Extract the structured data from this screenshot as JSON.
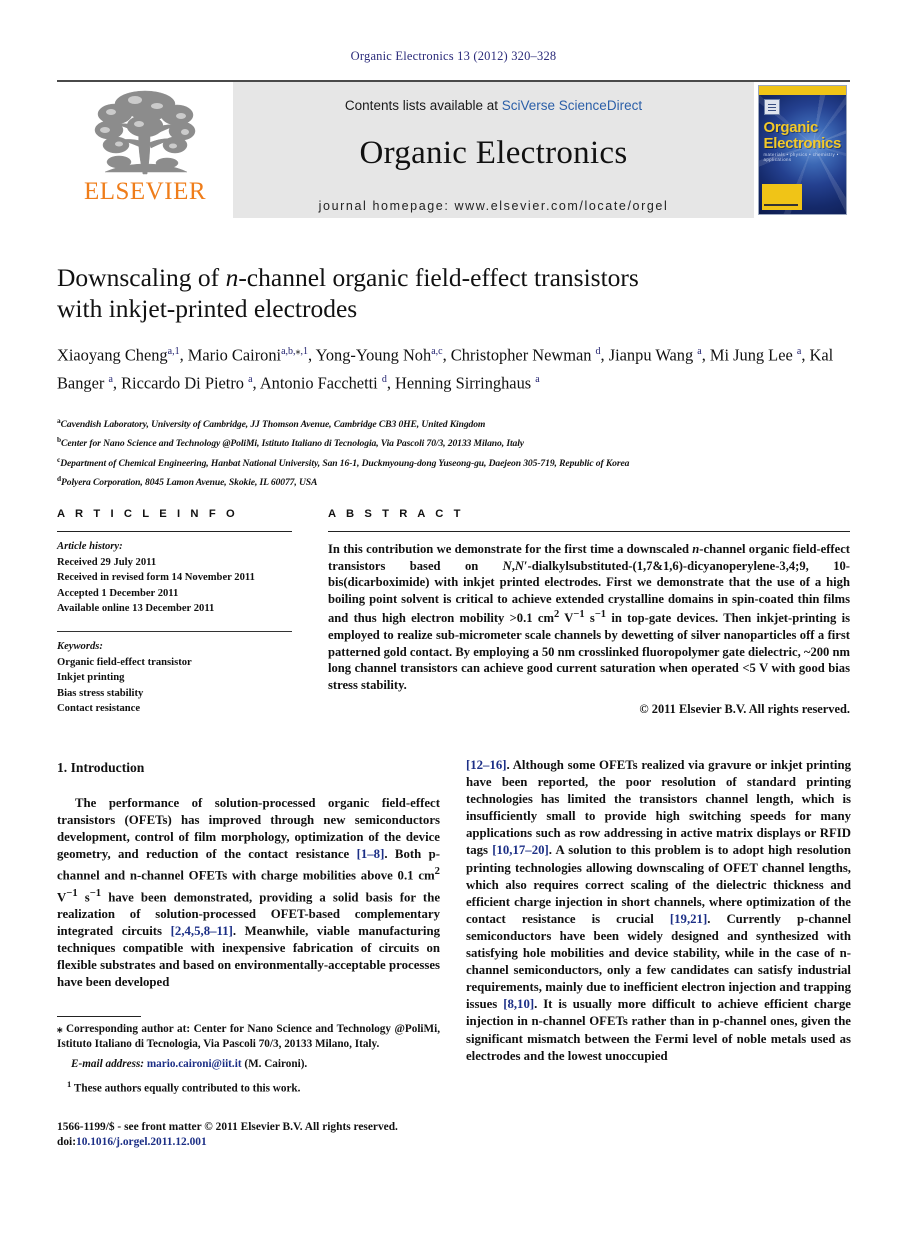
{
  "runhead": "Organic Electronics 13 (2012) 320–328",
  "masthead": {
    "contents_prefix": "Contents lists available at ",
    "sciencedirect": "SciVerse ScienceDirect",
    "journal_name": "Organic Electronics",
    "homepage": "journal homepage: www.elsevier.com/locate/orgel",
    "publisher_logo_text": "ELSEVIER",
    "cover": {
      "line1": "Organic",
      "line2": "Electronics",
      "subtitle": "materials • physics • chemistry • applications"
    },
    "accent_orange": "#ef7d1a",
    "link_blue": "#2b5fa8",
    "band_gray": "#e6e6e6"
  },
  "article": {
    "title_line1_a": "Downscaling of ",
    "title_line1_italic": "n",
    "title_line1_b": "-channel organic field-effect transistors",
    "title_line2": "with inkjet-printed electrodes",
    "authors_html": "Xiaoyang Cheng<sup>a,1</sup>, Mario Caironi<sup>a,b,<span class=\"star\">⁎</span>,1</sup>, Yong-Young Noh<sup>a,c</sup>, Christopher Newman <sup>d</sup>, Jianpu Wang <sup>a</sup>, Mi Jung Lee <sup>a</sup>, Kal Banger <sup>a</sup>, Riccardo Di Pietro <sup>a</sup>, Antonio Facchetti <sup>d</sup>, Henning Sirringhaus <sup>a</sup>",
    "affiliations": [
      {
        "mark": "a",
        "text": "Cavendish Laboratory, University of Cambridge, JJ Thomson Avenue, Cambridge CB3 0HE, United Kingdom"
      },
      {
        "mark": "b",
        "text": "Center for Nano Science and Technology @PoliMi, Istituto Italiano di Tecnologia, Via Pascoli 70/3, 20133 Milano, Italy"
      },
      {
        "mark": "c",
        "text": "Department of Chemical Engineering, Hanbat National University, San 16-1, Duckmyoung-dong Yuseong-gu, Daejeon 305-719, Republic of Korea"
      },
      {
        "mark": "d",
        "text": "Polyera Corporation, 8045 Lamon Avenue, Skokie, IL 60077, USA"
      }
    ]
  },
  "info": {
    "heading": "A R T I C L E   I N F O",
    "history_label": "Article history:",
    "history": [
      "Received 29 July 2011",
      "Received in revised form 14 November 2011",
      "Accepted 1 December 2011",
      "Available online 13 December 2011"
    ],
    "keywords_label": "Keywords:",
    "keywords": [
      "Organic field-effect transistor",
      "Inkjet printing",
      "Bias stress stability",
      "Contact resistance"
    ]
  },
  "abstract": {
    "heading": "A B S T R A C T",
    "body_html": "In this contribution we demonstrate for the first time a downscaled <i>n</i>-channel organic field-effect transistors based on <i>N</i>,<i>N</i>′-dialkylsubstituted-(1,7&amp;1,6)-dicyanoperylene-3,4;9, 10-bis(dicarboximide) with inkjet printed electrodes. First we demonstrate that the use of a high boiling point solvent is critical to achieve extended crystalline domains in spin-coated thin films and thus high electron mobility &gt;0.1 cm<sup>2</sup> V<sup>−1</sup> s<sup>−1</sup> in top-gate devices. Then inkjet-printing is employed to realize sub-micrometer scale channels by dewetting of silver nanoparticles off a first patterned gold contact. By employing a 50 nm crosslinked fluoropolymer gate dielectric, ~200 nm long channel transistors can achieve good current saturation when operated &lt;5 V with good bias stress stability.",
    "copyright": "© 2011 Elsevier B.V. All rights reserved."
  },
  "body": {
    "section_heading": "1. Introduction",
    "left_paragraph_html": "The performance of solution-processed organic field-effect transistors (OFETs) has improved through new semiconductors development, control of film morphology, optimization of the device geometry, and reduction of the contact resistance <span class=\"ref\">[1–8]</span>. Both p-channel and n-channel OFETs with charge mobilities above 0.1 cm<sup>2</sup> V<sup>−1</sup> s<sup>−1</sup> have been demonstrated, providing a solid basis for the realization of solution-processed OFET-based complementary integrated circuits <span class=\"ref\">[2,4,5,8–11]</span>. Meanwhile, viable manufacturing techniques compatible with inexpensive fabrication of circuits on flexible substrates and based on environmentally-acceptable processes have been developed",
    "right_paragraph_html": "<span class=\"ref\">[12–16]</span>. Although some OFETs realized via gravure or inkjet printing have been reported, the poor resolution of standard printing technologies has limited the transistors channel length, which is insufficiently small to provide high switching speeds for many applications such as row addressing in active matrix displays or RFID tags <span class=\"ref\">[10,17–20]</span>. A solution to this problem is to adopt high resolution printing technologies allowing downscaling of OFET channel lengths, which also requires correct scaling of the dielectric thickness and efficient charge injection in short channels, where optimization of the contact resistance is crucial <span class=\"ref\">[19,21]</span>. Currently p-channel semiconductors have been widely designed and synthesized with satisfying hole mobilities and device stability, while in the case of n-channel semiconductors, only a few candidates can satisfy industrial requirements, mainly due to inefficient electron injection and trapping issues <span class=\"ref\">[8,10]</span>. It is usually more difficult to achieve efficient charge injection in n-channel OFETs rather than in p-channel ones, given the significant mismatch between the Fermi level of noble metals used as electrodes and the lowest unoccupied"
  },
  "footnotes": {
    "corresponding_html": "<span class=\"mk\">⁎</span> Corresponding author at: Center for Nano Science and Technology @PoliMi, Istituto Italiano di Tecnologia, Via Pascoli 70/3, 20133 Milano, Italy.",
    "email_label": "E-mail address:",
    "email": "mario.caironi@iit.it",
    "email_suffix": " (M. Caironi).",
    "equal_contrib_html": "<sup>1</sup> These authors equally contributed to this work."
  },
  "issn": {
    "line1": "1566-1199/$ - see front matter © 2011 Elsevier B.V. All rights reserved.",
    "doi_prefix": "doi:",
    "doi": "10.1016/j.orgel.2011.12.001"
  }
}
